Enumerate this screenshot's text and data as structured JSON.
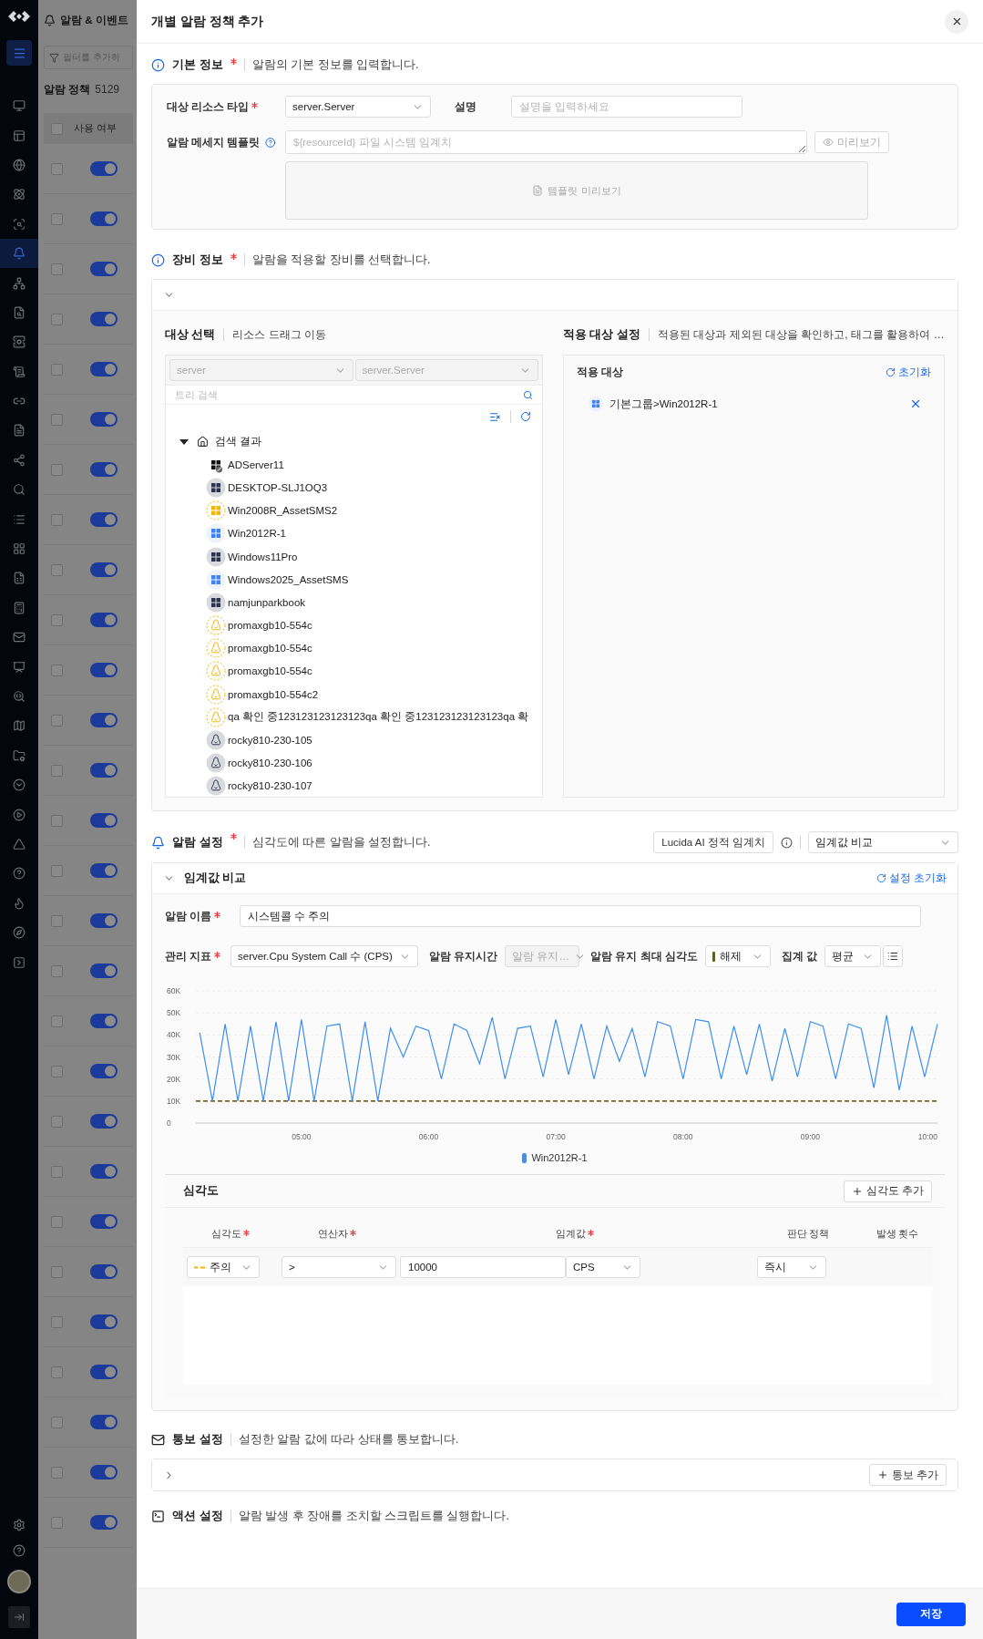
{
  "nav": {
    "menu_selected": true,
    "items": [
      {
        "selected": false
      },
      {
        "selected": false
      },
      {
        "selected": false
      },
      {
        "selected": false
      },
      {
        "selected": false
      },
      {
        "selected": true
      },
      {
        "selected": false
      },
      {
        "selected": false
      },
      {
        "selected": false
      },
      {
        "selected": false
      },
      {
        "selected": false
      },
      {
        "selected": false
      },
      {
        "selected": false
      },
      {
        "selected": false
      },
      {
        "selected": false
      },
      {
        "selected": false
      },
      {
        "selected": false
      },
      {
        "selected": false
      },
      {
        "selected": false
      },
      {
        "selected": false
      },
      {
        "selected": false
      },
      {
        "selected": false
      },
      {
        "selected": false
      },
      {
        "selected": false
      },
      {
        "selected": false
      },
      {
        "selected": false
      },
      {
        "selected": false
      },
      {
        "selected": false
      },
      {
        "selected": false
      },
      {
        "selected": false
      }
    ]
  },
  "background_page": {
    "title": "알람 & 이벤트",
    "filter_placeholder": "필터를 추가하",
    "list_title": "알람 정책",
    "count": "5129",
    "column": "사용 여부",
    "select_all_checked": false,
    "rows": [
      {
        "checked": false,
        "on": true
      },
      {
        "checked": false,
        "on": true
      },
      {
        "checked": false,
        "on": true
      },
      {
        "checked": false,
        "on": true
      },
      {
        "checked": false,
        "on": true
      },
      {
        "checked": false,
        "on": true
      },
      {
        "checked": false,
        "on": true
      },
      {
        "checked": false,
        "on": true
      },
      {
        "checked": false,
        "on": true
      },
      {
        "checked": false,
        "on": true
      },
      {
        "checked": false,
        "on": true
      },
      {
        "checked": false,
        "on": true
      },
      {
        "checked": false,
        "on": true
      },
      {
        "checked": false,
        "on": true
      },
      {
        "checked": false,
        "on": true
      },
      {
        "checked": false,
        "on": true
      },
      {
        "checked": false,
        "on": true
      },
      {
        "checked": false,
        "on": true
      },
      {
        "checked": false,
        "on": true
      },
      {
        "checked": false,
        "on": true
      },
      {
        "checked": false,
        "on": true
      },
      {
        "checked": false,
        "on": true
      },
      {
        "checked": false,
        "on": true
      },
      {
        "checked": false,
        "on": true
      },
      {
        "checked": false,
        "on": true
      },
      {
        "checked": false,
        "on": true
      },
      {
        "checked": false,
        "on": true
      },
      {
        "checked": false,
        "on": true
      }
    ]
  },
  "drawer": {
    "title": "개별 알람 정책 추가"
  },
  "basic_info": {
    "title": "기본 정보",
    "required": true,
    "description": "알람의 기본 정보를 입력합니다.",
    "resource_type_label": "대상 리소스 타입",
    "resource_type_required": true,
    "resource_type_value": "server.Server",
    "description_label": "설명",
    "description_placeholder": "설명을 입력하세요",
    "template_label": "알람 메세지 템플릿",
    "template_placeholder": "${resourceId} 파일 시스템 임계치",
    "preview_button": "미리보기",
    "preview_area": "템플릿 미리보기"
  },
  "device_info": {
    "title": "장비 정보",
    "required": true,
    "description": "알람을 적용할 장비를 선택합니다.",
    "expanded": true,
    "target_select": {
      "title": "대상 선택",
      "subtitle": "리소스 드래그 이동",
      "filter_1": "server",
      "filter_2": "server.Server",
      "search_placeholder": "트리 검색",
      "tree": [
        {
          "label": "검색 결과",
          "expanded": true,
          "children": [
            {
              "label": "ADServer11",
              "kind": "windows",
              "blocked": true,
              "offline": false,
              "warning": false
            },
            {
              "label": "DESKTOP-SLJ1OQ3",
              "kind": "windows",
              "blocked": false,
              "offline": true,
              "warning": false
            },
            {
              "label": "Win2008R_AssetSMS2",
              "kind": "windows",
              "blocked": false,
              "offline": false,
              "warning": true
            },
            {
              "label": "Win2012R-1",
              "kind": "windows",
              "blocked": false,
              "offline": false,
              "warning": false
            },
            {
              "label": "Windows11Pro",
              "kind": "windows",
              "blocked": false,
              "offline": true,
              "warning": false
            },
            {
              "label": "Windows2025_AssetSMS",
              "kind": "windows",
              "blocked": false,
              "offline": false,
              "warning": false
            },
            {
              "label": "namjunparkbook",
              "kind": "windows",
              "blocked": false,
              "offline": true,
              "warning": false
            },
            {
              "label": "promaxgb10-554c",
              "kind": "linux",
              "blocked": false,
              "offline": false,
              "warning": true
            },
            {
              "label": "promaxgb10-554c",
              "kind": "linux",
              "blocked": false,
              "offline": false,
              "warning": true
            },
            {
              "label": "promaxgb10-554c",
              "kind": "linux",
              "blocked": false,
              "offline": false,
              "warning": true
            },
            {
              "label": "promaxgb10-554c2",
              "kind": "linux",
              "blocked": false,
              "offline": false,
              "warning": true
            },
            {
              "label": "qa 확인 중123123123123123qa 확인 중123123123123123qa 확",
              "kind": "linux",
              "blocked": false,
              "offline": false,
              "warning": true
            },
            {
              "label": "rocky810-230-105",
              "kind": "linux",
              "blocked": false,
              "offline": true,
              "warning": false
            },
            {
              "label": "rocky810-230-106",
              "kind": "linux",
              "blocked": false,
              "offline": true,
              "warning": false
            },
            {
              "label": "rocky810-230-107",
              "kind": "linux",
              "blocked": false,
              "offline": true,
              "warning": false
            }
          ]
        }
      ]
    },
    "apply_target": {
      "title": "적용 대상 설정",
      "subtitle": "적용된 대상과 제외된 대상을 확인하고, 태그를 활용하여 …",
      "list_title": "적용 대상",
      "reset": "초기화",
      "items": [
        {
          "label": "기본그룹>Win2012R-1",
          "kind": "windows"
        }
      ]
    }
  },
  "alarm_settings": {
    "title": "알람 설정",
    "required": true,
    "description": "심각도에 따른 알람을 설정합니다.",
    "ai_button": "Lucida AI 정적 임계치",
    "mode_select": "임계값 비교",
    "panel": {
      "title": "임계값 비교",
      "expanded": true,
      "reset": "설정 초기화",
      "alarm_name_label": "알람 이름",
      "alarm_name_value": "시스템콜 수 주의",
      "metric_label": "관리 지표",
      "metric_value": "server.Cpu System Call 수 (CPS)",
      "duration_label": "알람 유지시간",
      "duration_placeholder": "알람 유지…",
      "max_severity_label": "알람 유지 최대 심각도",
      "max_severity_value": "해제",
      "aggregate_label": "집계 값",
      "aggregate_value": "평균",
      "chart_data": {
        "type": "line",
        "grid": true,
        "xlim": [
          4.17,
          10.0
        ],
        "ylim": [
          0,
          60000
        ],
        "xticks": [
          {
            "value": 5,
            "label": "05:00"
          },
          {
            "value": 6,
            "label": "06:00"
          },
          {
            "value": 7,
            "label": "07:00"
          },
          {
            "value": 8,
            "label": "08:00"
          },
          {
            "value": 9,
            "label": "09:00"
          },
          {
            "value": 10,
            "label": "10:00"
          }
        ],
        "yticks": [
          {
            "value": 0,
            "label": "0"
          },
          {
            "value": 10000,
            "label": "10K"
          },
          {
            "value": 20000,
            "label": "20K"
          },
          {
            "value": 30000,
            "label": "30K"
          },
          {
            "value": 40000,
            "label": "40K"
          },
          {
            "value": 50000,
            "label": "50K"
          },
          {
            "value": 60000,
            "label": "60K"
          }
        ],
        "x": [
          4.2,
          4.3,
          4.4,
          4.5,
          4.6,
          4.7,
          4.8,
          4.9,
          5.0,
          5.1,
          5.2,
          5.3,
          5.4,
          5.5,
          5.6,
          5.7,
          5.8,
          5.9,
          6.0,
          6.1,
          6.2,
          6.3,
          6.4,
          6.5,
          6.6,
          6.7,
          6.8,
          6.9,
          7.0,
          7.1,
          7.2,
          7.3,
          7.4,
          7.5,
          7.6,
          7.7,
          7.8,
          7.9,
          8.0,
          8.1,
          8.2,
          8.3,
          8.4,
          8.5,
          8.6,
          8.7,
          8.8,
          8.9,
          9.0,
          9.1,
          9.2,
          9.3,
          9.4,
          9.5,
          9.6,
          9.7,
          9.8,
          9.9,
          10.0
        ],
        "series": [
          {
            "name": "Win2012R-1",
            "color": "#3d8ff0",
            "values": [
              41000,
              10000,
              45000,
              10000,
              44000,
              10000,
              46000,
              10000,
              47000,
              10000,
              44000,
              45000,
              10000,
              46000,
              10000,
              43000,
              30000,
              44000,
              42000,
              20000,
              45000,
              42000,
              27000,
              48000,
              20000,
              43000,
              44000,
              21000,
              47000,
              22000,
              45000,
              20000,
              44000,
              28000,
              43000,
              21000,
              46000,
              44000,
              20000,
              47000,
              46000,
              20000,
              44000,
              22000,
              45000,
              19000,
              43000,
              21000,
              46000,
              44000,
              20000,
              45000,
              43000,
              16000,
              49000,
              15000,
              44000,
              21000,
              45000
            ]
          }
        ],
        "ref_lines": [
          {
            "axis": "y",
            "value": 10000
          }
        ]
      },
      "severity": {
        "title": "심각도",
        "add_button": "심각도 추가",
        "columns": [
          {
            "label": "심각도",
            "required": true
          },
          {
            "label": "연산자",
            "required": true
          },
          {
            "label": "임계값",
            "required": true
          },
          {
            "label": "판단 정책",
            "required": false
          },
          {
            "label": "발생 횟수",
            "required": false
          }
        ],
        "rows": [
          {
            "severity": "주의",
            "operator": ">",
            "threshold": "10000",
            "unit": "CPS",
            "policy": "즉시"
          }
        ]
      }
    }
  },
  "notification": {
    "title": "통보 설정",
    "required": false,
    "description": "설정한 알람 값에 따라 상태를 통보합니다.",
    "expanded": false,
    "add_button": "통보 추가"
  },
  "action": {
    "title": "액션 설정",
    "required": false,
    "description": "알람 발생 후 장애를 조치할 스크립트를 실행합니다."
  },
  "footer": {
    "save_button": "저장"
  }
}
